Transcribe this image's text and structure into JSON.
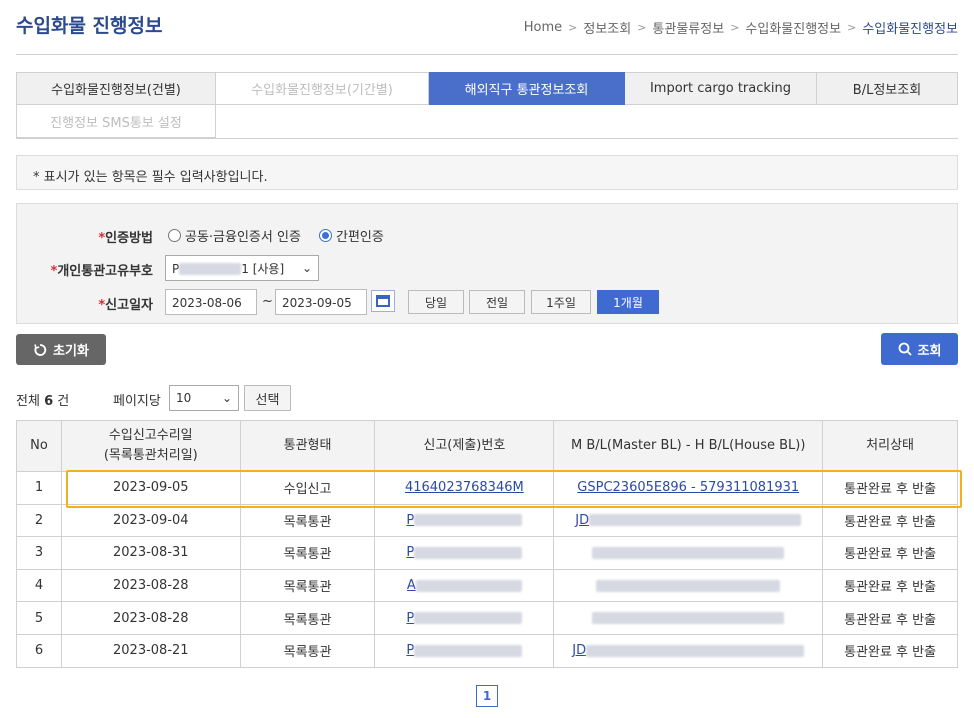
{
  "page_title": "수입화물 진행정보",
  "breadcrumb": [
    "Home",
    "정보조회",
    "통관물류정보",
    "수입화물진행정보",
    "수입화물진행정보"
  ],
  "tabs_row1": [
    {
      "label": "수입화물진행정보(건별)",
      "state": "normal"
    },
    {
      "label": "수입화물진행정보(기간별)",
      "state": "disabled"
    },
    {
      "label": "해외직구 통관정보조회",
      "state": "active"
    },
    {
      "label": "Import cargo tracking",
      "state": "normal"
    },
    {
      "label": "B/L정보조회",
      "state": "normal"
    }
  ],
  "tabs_row2": [
    {
      "label": "진행정보 SMS통보 설정",
      "state": "disabled"
    }
  ],
  "notice": "* 표시가 있는 항목은 필수 입력사항입니다.",
  "form": {
    "auth_label": "인증방법",
    "auth_opt1": "공동·금융인증서 인증",
    "auth_opt2": "간편인증",
    "pcc_label": "개인통관고유부호",
    "pcc_prefix": "P",
    "pcc_suffix": "1 [사용]",
    "date_label": "신고일자",
    "date_from": "2023-08-06",
    "date_tilde": "~",
    "date_to": "2023-09-05",
    "period_buttons": [
      "당일",
      "전일",
      "1주일",
      "1개월"
    ],
    "period_selected": "1개월"
  },
  "buttons": {
    "reset": "초기화",
    "search": "조회",
    "select": "선택"
  },
  "list": {
    "total_prefix": "전체",
    "total_count": "6",
    "total_suffix": "건",
    "per_page_label": "페이지당",
    "per_page_value": "10"
  },
  "table": {
    "headers": [
      "No",
      "수입신고수리일",
      "(목록통관처리일)",
      "통관형태",
      "신고(제출)번호",
      "M B/L(Master BL) - H B/L(House BL))",
      "처리상태"
    ],
    "rows": [
      {
        "no": "1",
        "date": "2023-09-05",
        "type": "수입신고",
        "decl": "4164023768346M",
        "bl": "GSPC23605E896 - 579311081931",
        "status": "통관완료 후 반출"
      },
      {
        "no": "2",
        "date": "2023-09-04",
        "type": "목록통관",
        "decl": "P",
        "bl": "JD",
        "status": "통관완료 후 반출"
      },
      {
        "no": "3",
        "date": "2023-08-31",
        "type": "목록통관",
        "decl": "P",
        "bl": "",
        "status": "통관완료 후 반출"
      },
      {
        "no": "4",
        "date": "2023-08-28",
        "type": "목록통관",
        "decl": "A",
        "bl": "",
        "status": "통관완료 후 반출"
      },
      {
        "no": "5",
        "date": "2023-08-28",
        "type": "목록통관",
        "decl": "P",
        "bl": "",
        "status": "통관완료 후 반출"
      },
      {
        "no": "6",
        "date": "2023-08-21",
        "type": "목록통관",
        "decl": "P",
        "bl": "JD",
        "status": "통관완료 후 반출"
      }
    ]
  },
  "pagination": {
    "current": "1"
  }
}
